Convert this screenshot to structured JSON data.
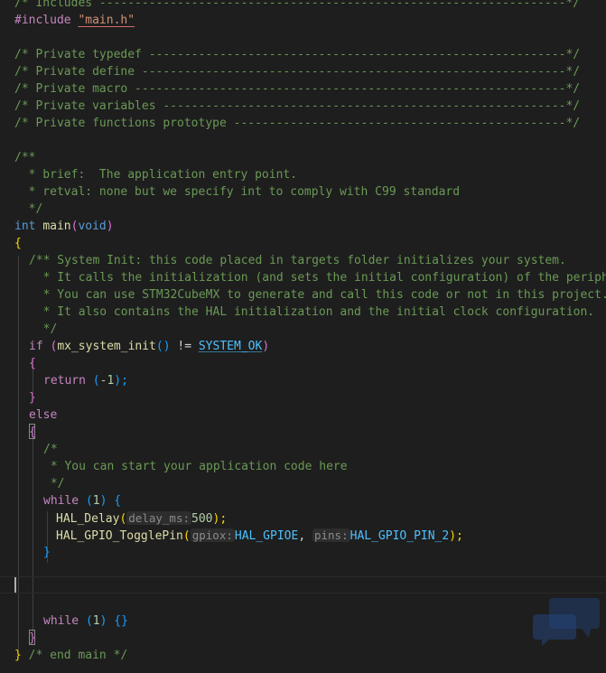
{
  "editor": {
    "l0a": "/* Includes ------------------------------------------------------------------*/",
    "l1pp": "#include ",
    "l1str": "\"main.h\"",
    "l3": "/* Private typedef -----------------------------------------------------------*/",
    "l4": "/* Private define ------------------------------------------------------------*/",
    "l5": "/* Private macro -------------------------------------------------------------*/",
    "l6": "/* Private variables ---------------------------------------------------------*/",
    "l7": "/* Private functions prototype -----------------------------------------------*/",
    "l9": "/**",
    "l10": "  * brief:  The application entry point.",
    "l11": "  * retval: none but we specify int to comply with C99 standard",
    "l12": "  */",
    "l13_kw": "int",
    "l13_fn": "main",
    "l13_open": "(",
    "l13_void": "void",
    "l13_close": ")",
    "l14": "{",
    "l15": "/** System Init: this code placed in targets folder initializes your system.",
    "l16": "  * It calls the initialization (and sets the initial configuration) of the peripherals.",
    "l17": "  * You can use STM32CubeMX to generate and call this code or not in this project.",
    "l18": "  * It also contains the HAL initialization and the initial clock configuration.",
    "l19": "  */",
    "l20_if": "if",
    "l20_open": " (",
    "l20_fn": "mx_system_init",
    "l20_call": "()",
    "l20_op": " != ",
    "l20_cst": "SYSTEM_OK",
    "l20_close": ")",
    "l21": "{",
    "l22_ret": "return",
    "l22_open": " (",
    "l22_val": "-1",
    "l22_close": ");",
    "l23": "}",
    "l24": "else",
    "l25": "{",
    "l26": "/*",
    "l27": " * You can start your application code here",
    "l28": " */",
    "l29_kw": "while",
    "l29_open": " (",
    "l29_num": "1",
    "l29_close": ")",
    "l29_brace": " {",
    "l30_fn": "HAL_Delay",
    "l30_open": "(",
    "l30_hint": "delay_ms:",
    "l30_num": "500",
    "l30_close": ");",
    "l31_fn": "HAL_GPIO_TogglePin",
    "l31_open": "(",
    "l31_hint1": "gpiox:",
    "l31_cst1": "HAL_GPIOE",
    "l31_comma": ", ",
    "l31_hint2": "pins:",
    "l31_cst2": "HAL_GPIO_PIN_2",
    "l31_close": ");",
    "l32": "}",
    "l36_kw": "while",
    "l36_open": " (",
    "l36_num": "1",
    "l36_close": ")",
    "l36_braces": " {}",
    "l37": "}",
    "l38_brace": "}",
    "l38_cm": " /* end main */"
  },
  "colors": {
    "background": "#1e1e1e",
    "comment": "#6a9955",
    "keyword": "#569cd6",
    "control": "#c586c0",
    "function": "#dcdcaa",
    "constant": "#4fc1ff",
    "number": "#b5cea8",
    "string": "#ce9178"
  }
}
